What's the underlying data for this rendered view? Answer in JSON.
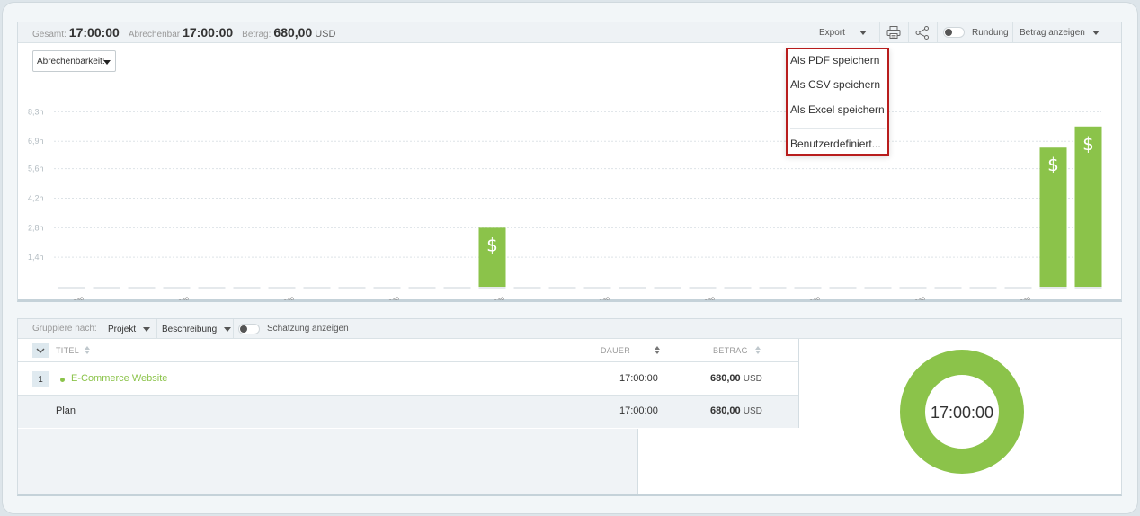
{
  "summary": {
    "total_label": "Gesamt:",
    "total_value": "17:00:00",
    "billable_label": "Abrechenbar",
    "billable_value": "17:00:00",
    "amount_label": "Betrag:",
    "amount_value": "680,00",
    "amount_currency": "USD"
  },
  "toolbar": {
    "export_label": "Export",
    "print_icon": "printer-icon",
    "share_icon": "share-icon",
    "rounding_label": "Rundung",
    "rounding_enabled": false,
    "show_amount_label": "Betrag anzeigen"
  },
  "filter": {
    "billable_dropdown": "Abrechenbarkeit:"
  },
  "export_menu": {
    "items": [
      "Als PDF speichern",
      "Als CSV speichern",
      "Als Excel speichern"
    ],
    "custom_item": "Benutzerdefiniert..."
  },
  "chart_data": {
    "type": "bar",
    "y_ticks": [
      "1,4h",
      "2,8h",
      "4,2h",
      "5,6h",
      "6,9h",
      "8,3h"
    ],
    "ylim": [
      0,
      9.7
    ],
    "x_labels": [
      "Mo., 1. Sep",
      "Do., 4. Sep",
      "So., 7. Sep",
      "Mi., 10. Sep",
      "Fr., 13. Sep",
      "Di., 16. Sep",
      "Fr., 19. Sep",
      "Mon., 22. Sep",
      "Do., 25. Sep",
      "So., 28. Sep"
    ],
    "days": [
      1,
      2,
      3,
      4,
      5,
      6,
      7,
      8,
      9,
      10,
      11,
      12,
      13,
      14,
      15,
      16,
      17,
      18,
      19,
      20,
      21,
      22,
      23,
      24,
      25,
      26,
      27,
      28,
      29,
      30
    ],
    "values": [
      0,
      0,
      0,
      0,
      0,
      0,
      0,
      0,
      0,
      0,
      0,
      0,
      2.8,
      0,
      0,
      0,
      0,
      0,
      0,
      0,
      0,
      0,
      0,
      0,
      0,
      0,
      0,
      0,
      6.6,
      7.6
    ],
    "bar_color": "#8bc34a",
    "bar_icon": "$",
    "grid": true
  },
  "grouping": {
    "label": "Gruppiere nach:",
    "group1": "Projekt",
    "group2": "Beschreibung",
    "estimate_label": "Schätzung anzeigen",
    "estimate_enabled": false
  },
  "table": {
    "col_title": "TITEL",
    "col_duration": "DAUER",
    "col_amount": "BETRAG",
    "rows": [
      {
        "num": "1",
        "title": "E-Commerce Website",
        "duration": "17:00:00",
        "amount": "680,00",
        "currency": "USD"
      }
    ],
    "total_row": {
      "title": "Plan",
      "duration": "17:00:00",
      "amount": "680,00",
      "currency": "USD"
    }
  },
  "donut": {
    "center_text": "17:00:00",
    "color": "#8bc34a",
    "share": 1.0
  }
}
